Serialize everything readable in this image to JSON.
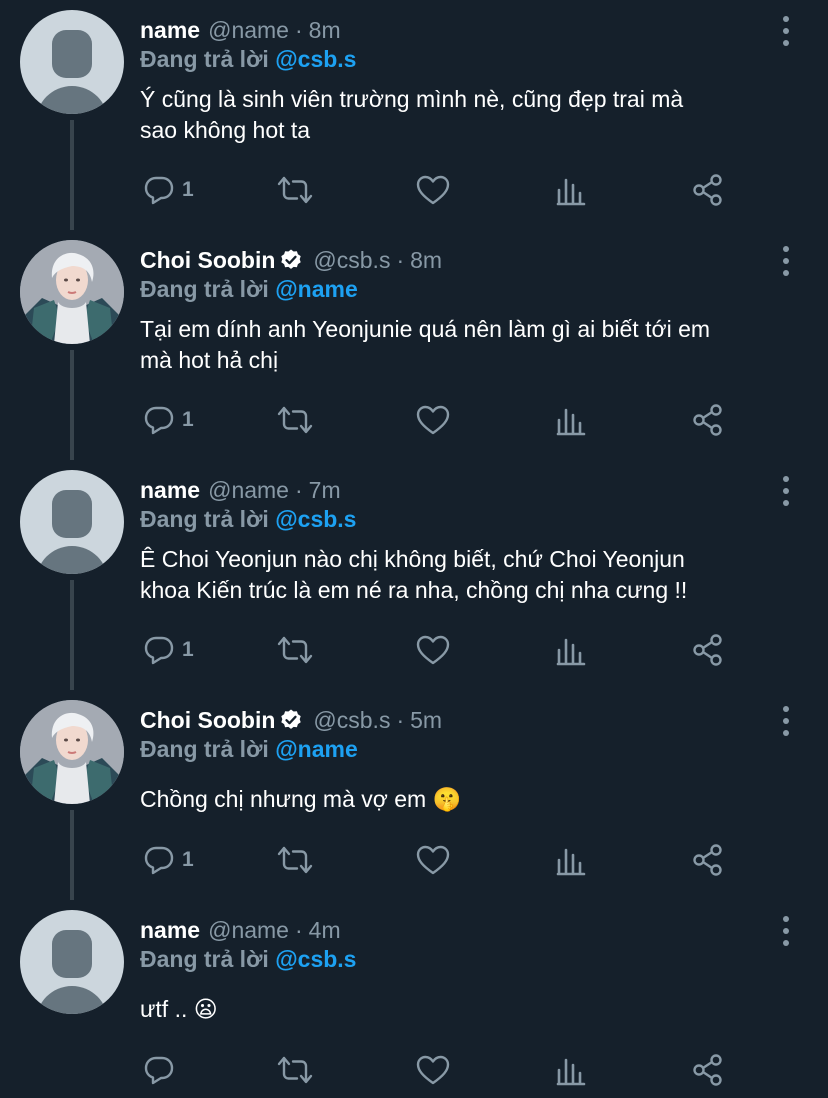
{
  "colors": {
    "background": "#15202b",
    "secondary_text": "#8899a6",
    "mention": "#1da1f2",
    "thread_line": "#38444d"
  },
  "tweets": [
    {
      "display_name": "name",
      "handle": "@name",
      "separator": "·",
      "time": "8m",
      "verified": false,
      "reply_prefix": "Đang trả lời",
      "reply_to": "@csb.s",
      "text_lines": [
        "Ý cũng là sinh viên trường mình nè, cũng đẹp trai mà",
        "sao không hot ta"
      ],
      "reply_count": "1"
    },
    {
      "display_name": "Choi Soobin",
      "handle": "@csb.s",
      "separator": "·",
      "time": "8m",
      "verified": true,
      "reply_prefix": "Đang trả lời",
      "reply_to": "@name",
      "text_lines": [
        "Tại em dính anh Yeonjunie quá nên làm gì ai biết tới em",
        "mà hot hả chị"
      ],
      "reply_count": "1"
    },
    {
      "display_name": "name",
      "handle": "@name",
      "separator": "·",
      "time": "7m",
      "verified": false,
      "reply_prefix": "Đang trả lời",
      "reply_to": "@csb.s",
      "text_lines": [
        "Ê Choi Yeonjun nào chị không biết, chứ Choi Yeonjun",
        "khoa Kiến trúc là em né ra nha, chồng chị nha cưng !!"
      ],
      "reply_count": "1"
    },
    {
      "display_name": "Choi Soobin",
      "handle": "@csb.s",
      "separator": "·",
      "time": "5m",
      "verified": true,
      "reply_prefix": "Đang trả lời",
      "reply_to": "@name",
      "text_lines": [
        "Chồng chị nhưng mà vợ em 🤫"
      ],
      "reply_count": "1"
    },
    {
      "display_name": "name",
      "handle": "@name",
      "separator": "·",
      "time": "4m",
      "verified": false,
      "reply_prefix": "Đang trả lời",
      "reply_to": "@csb.s",
      "text_lines": [
        "ưtf .. 😦"
      ],
      "reply_count": ""
    }
  ],
  "icons": {
    "reply": "reply-icon",
    "retweet": "retweet-icon",
    "like": "heart-icon",
    "analytics": "analytics-icon",
    "share": "share-icon",
    "more": "more-vertical-icon",
    "verified": "verified-badge-icon"
  }
}
